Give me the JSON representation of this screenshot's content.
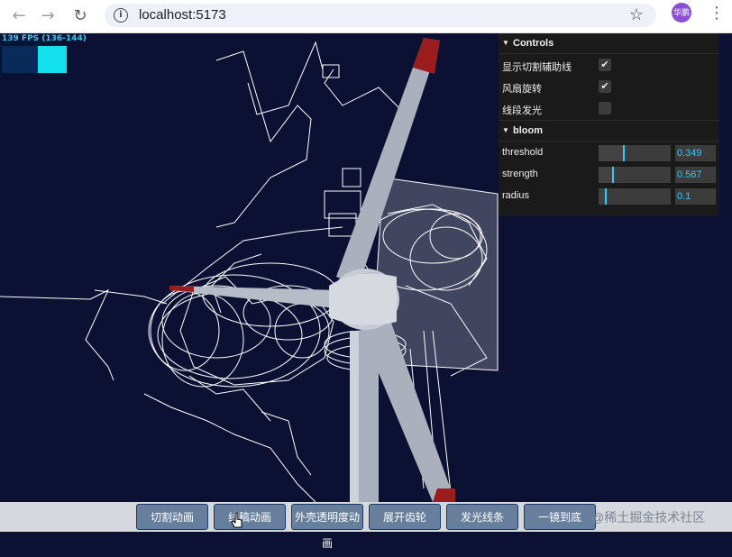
{
  "browser": {
    "url": "localhost:5173",
    "avatar_text": "华鹏",
    "icons": [
      "back-icon",
      "forward-icon",
      "reload-icon",
      "info-icon",
      "star-icon",
      "menu-icon"
    ]
  },
  "stats": {
    "text": "139 FPS (136-144)"
  },
  "gui": {
    "controls_title": "Controls",
    "toggles": [
      {
        "label": "显示切割辅助线",
        "checked": true
      },
      {
        "label": "风扇旋转",
        "checked": true
      },
      {
        "label": "线段发光",
        "checked": false
      }
    ],
    "bloom_title": "bloom",
    "sliders": [
      {
        "label": "threshold",
        "value": "0.349",
        "fraction": 0.349
      },
      {
        "label": "strength",
        "value": "0.567",
        "fraction": 0.2
      },
      {
        "label": "radius",
        "value": "0.1",
        "fraction": 0.1
      }
    ]
  },
  "buttons": [
    "切割动画",
    "线稿动画",
    "外壳透明度动画",
    "展开齿轮",
    "发光线条",
    "一镜到底"
  ],
  "watermark": "@稀土掘金技术社区"
}
